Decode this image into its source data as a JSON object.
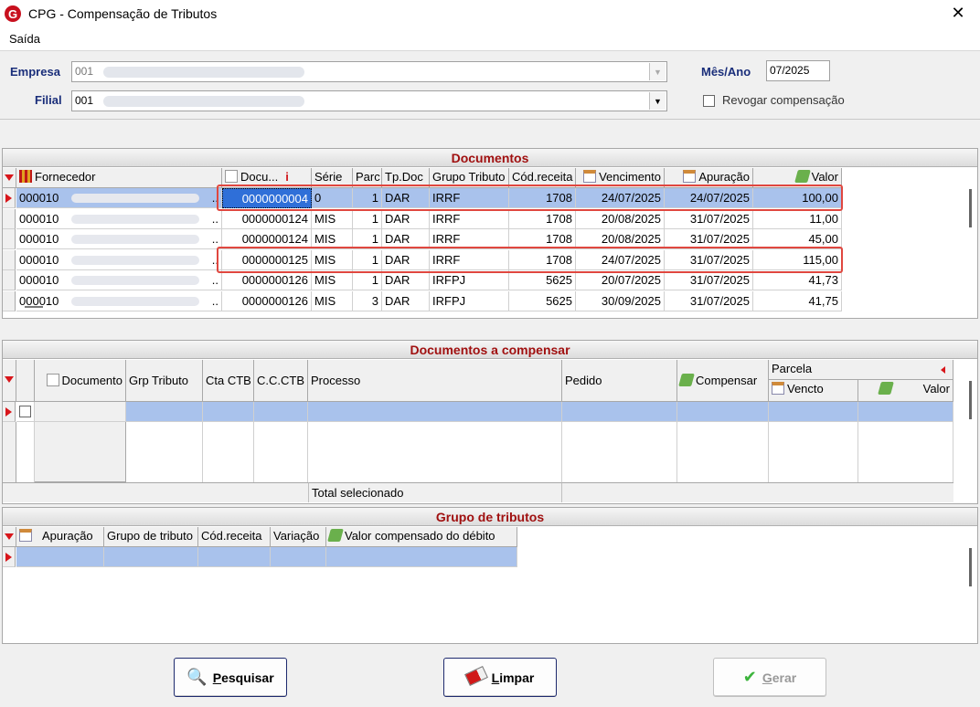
{
  "window": {
    "title": "CPG - Compensação de Tributos",
    "logo_letter": "G",
    "close_glyph": "✕"
  },
  "menu": {
    "items": [
      "Saída"
    ]
  },
  "header": {
    "empresa_label": "Empresa",
    "empresa_value": "001",
    "filial_label": "Filial",
    "filial_value": "001",
    "mesano_label": "Mês/Ano",
    "mesano_value": "07/2025",
    "revogar_label": "Revogar compensação"
  },
  "documentos": {
    "title": "Documentos",
    "columns": [
      "Fornecedor",
      "Docu...",
      "Série",
      "Parc",
      "Tp.Doc",
      "Grupo Tributo",
      "Cód.receita",
      "Vencimento",
      "Apuração",
      "Valor"
    ],
    "info_glyph": "i",
    "rows": [
      {
        "fornecedor": "000010",
        "doc": "0000000004",
        "serie": "0",
        "parc": "1",
        "tpdoc": "DAR",
        "grupo": "IRRF",
        "cod": "1708",
        "venc": "24/07/2025",
        "apur": "24/07/2025",
        "valor": "100,00"
      },
      {
        "fornecedor": "000010",
        "doc": "0000000124",
        "serie": "MIS",
        "parc": "1",
        "tpdoc": "DAR",
        "grupo": "IRRF",
        "cod": "1708",
        "venc": "20/08/2025",
        "apur": "31/07/2025",
        "valor": "11,00"
      },
      {
        "fornecedor": "000010",
        "doc": "0000000124",
        "serie": "MIS",
        "parc": "1",
        "tpdoc": "DAR",
        "grupo": "IRRF",
        "cod": "1708",
        "venc": "20/08/2025",
        "apur": "31/07/2025",
        "valor": "45,00"
      },
      {
        "fornecedor": "000010",
        "doc": "0000000125",
        "serie": "MIS",
        "parc": "1",
        "tpdoc": "DAR",
        "grupo": "IRRF",
        "cod": "1708",
        "venc": "24/07/2025",
        "apur": "31/07/2025",
        "valor": "115,00"
      },
      {
        "fornecedor": "000010",
        "doc": "0000000126",
        "serie": "MIS",
        "parc": "1",
        "tpdoc": "DAR",
        "grupo": "IRFPJ",
        "cod": "5625",
        "venc": "20/07/2025",
        "apur": "31/07/2025",
        "valor": "41,73"
      },
      {
        "fornecedor": "000010",
        "doc": "0000000126",
        "serie": "MIS",
        "parc": "3",
        "tpdoc": "DAR",
        "grupo": "IRFPJ",
        "cod": "5625",
        "venc": "30/09/2025",
        "apur": "31/07/2025",
        "valor": "41,75"
      }
    ],
    "ellipsis": ".."
  },
  "compensar": {
    "title": "Documentos a compensar",
    "columns": [
      "Documento",
      "Grp Tributo",
      "Cta CTB",
      "C.C.CTB",
      "Processo",
      "Pedido",
      "Compensar",
      "Parcela",
      "Vencto",
      "Valor"
    ],
    "total_label": "Total selecionado"
  },
  "grupo": {
    "title": "Grupo de tributos",
    "columns": [
      "Apuração",
      "Grupo de tributo",
      "Cód.receita",
      "Variação",
      "Valor compensado do débito"
    ]
  },
  "buttons": {
    "pesquisar": {
      "mnemonic": "P",
      "rest": "esquisar"
    },
    "limpar": {
      "mnemonic": "L",
      "rest": "impar"
    },
    "gerar": {
      "mnemonic": "G",
      "rest": "erar"
    },
    "check_glyph": "✔",
    "search_glyph": "🔍"
  },
  "colors": {
    "accent_title": "#a01010",
    "label_blue": "#1a2e7a",
    "selection": "#a9c2ec",
    "highlight": "#e0473f"
  }
}
